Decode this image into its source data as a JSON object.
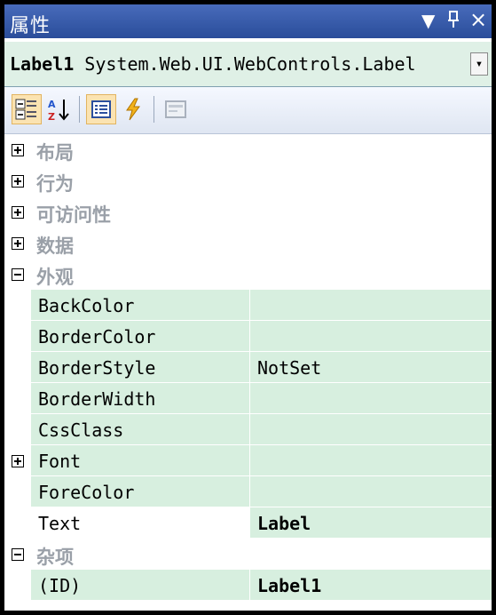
{
  "window": {
    "title": "属性",
    "controls": {
      "dropdown": "▼",
      "pin": "ᵽ",
      "close": "×"
    }
  },
  "object_selector": {
    "name": "Label1",
    "type": "System.Web.UI.WebControls.Label",
    "dropdown_glyph": "▾"
  },
  "toolbar": {
    "buttons": [
      {
        "icon": "categorized-icon",
        "active": true
      },
      {
        "icon": "alphabetical-sort-icon",
        "active": false
      },
      {
        "icon": "properties-icon",
        "active": true
      },
      {
        "icon": "events-lightning-icon",
        "active": false
      },
      {
        "icon": "property-pages-icon",
        "active": false
      }
    ]
  },
  "grid": {
    "categories": {
      "layout": "布局",
      "behavior": "行为",
      "accessibility": "可访问性",
      "data": "数据",
      "appearance": "外观",
      "misc": "杂项"
    },
    "appearance_props": [
      {
        "name": "BackColor",
        "value": ""
      },
      {
        "name": "BorderColor",
        "value": ""
      },
      {
        "name": "BorderStyle",
        "value": "NotSet"
      },
      {
        "name": "BorderWidth",
        "value": ""
      },
      {
        "name": "CssClass",
        "value": ""
      },
      {
        "name": "Font",
        "value": ""
      },
      {
        "name": "ForeColor",
        "value": ""
      },
      {
        "name": "Text",
        "value": "Label"
      }
    ],
    "misc_props": [
      {
        "name": "(ID)",
        "value": "Label1"
      }
    ]
  },
  "colors": {
    "title_bar": "#2a4d9a",
    "row_bg": "#d7efdf",
    "category_text": "#9aa0a8",
    "active_button": "#fbe3b1"
  }
}
